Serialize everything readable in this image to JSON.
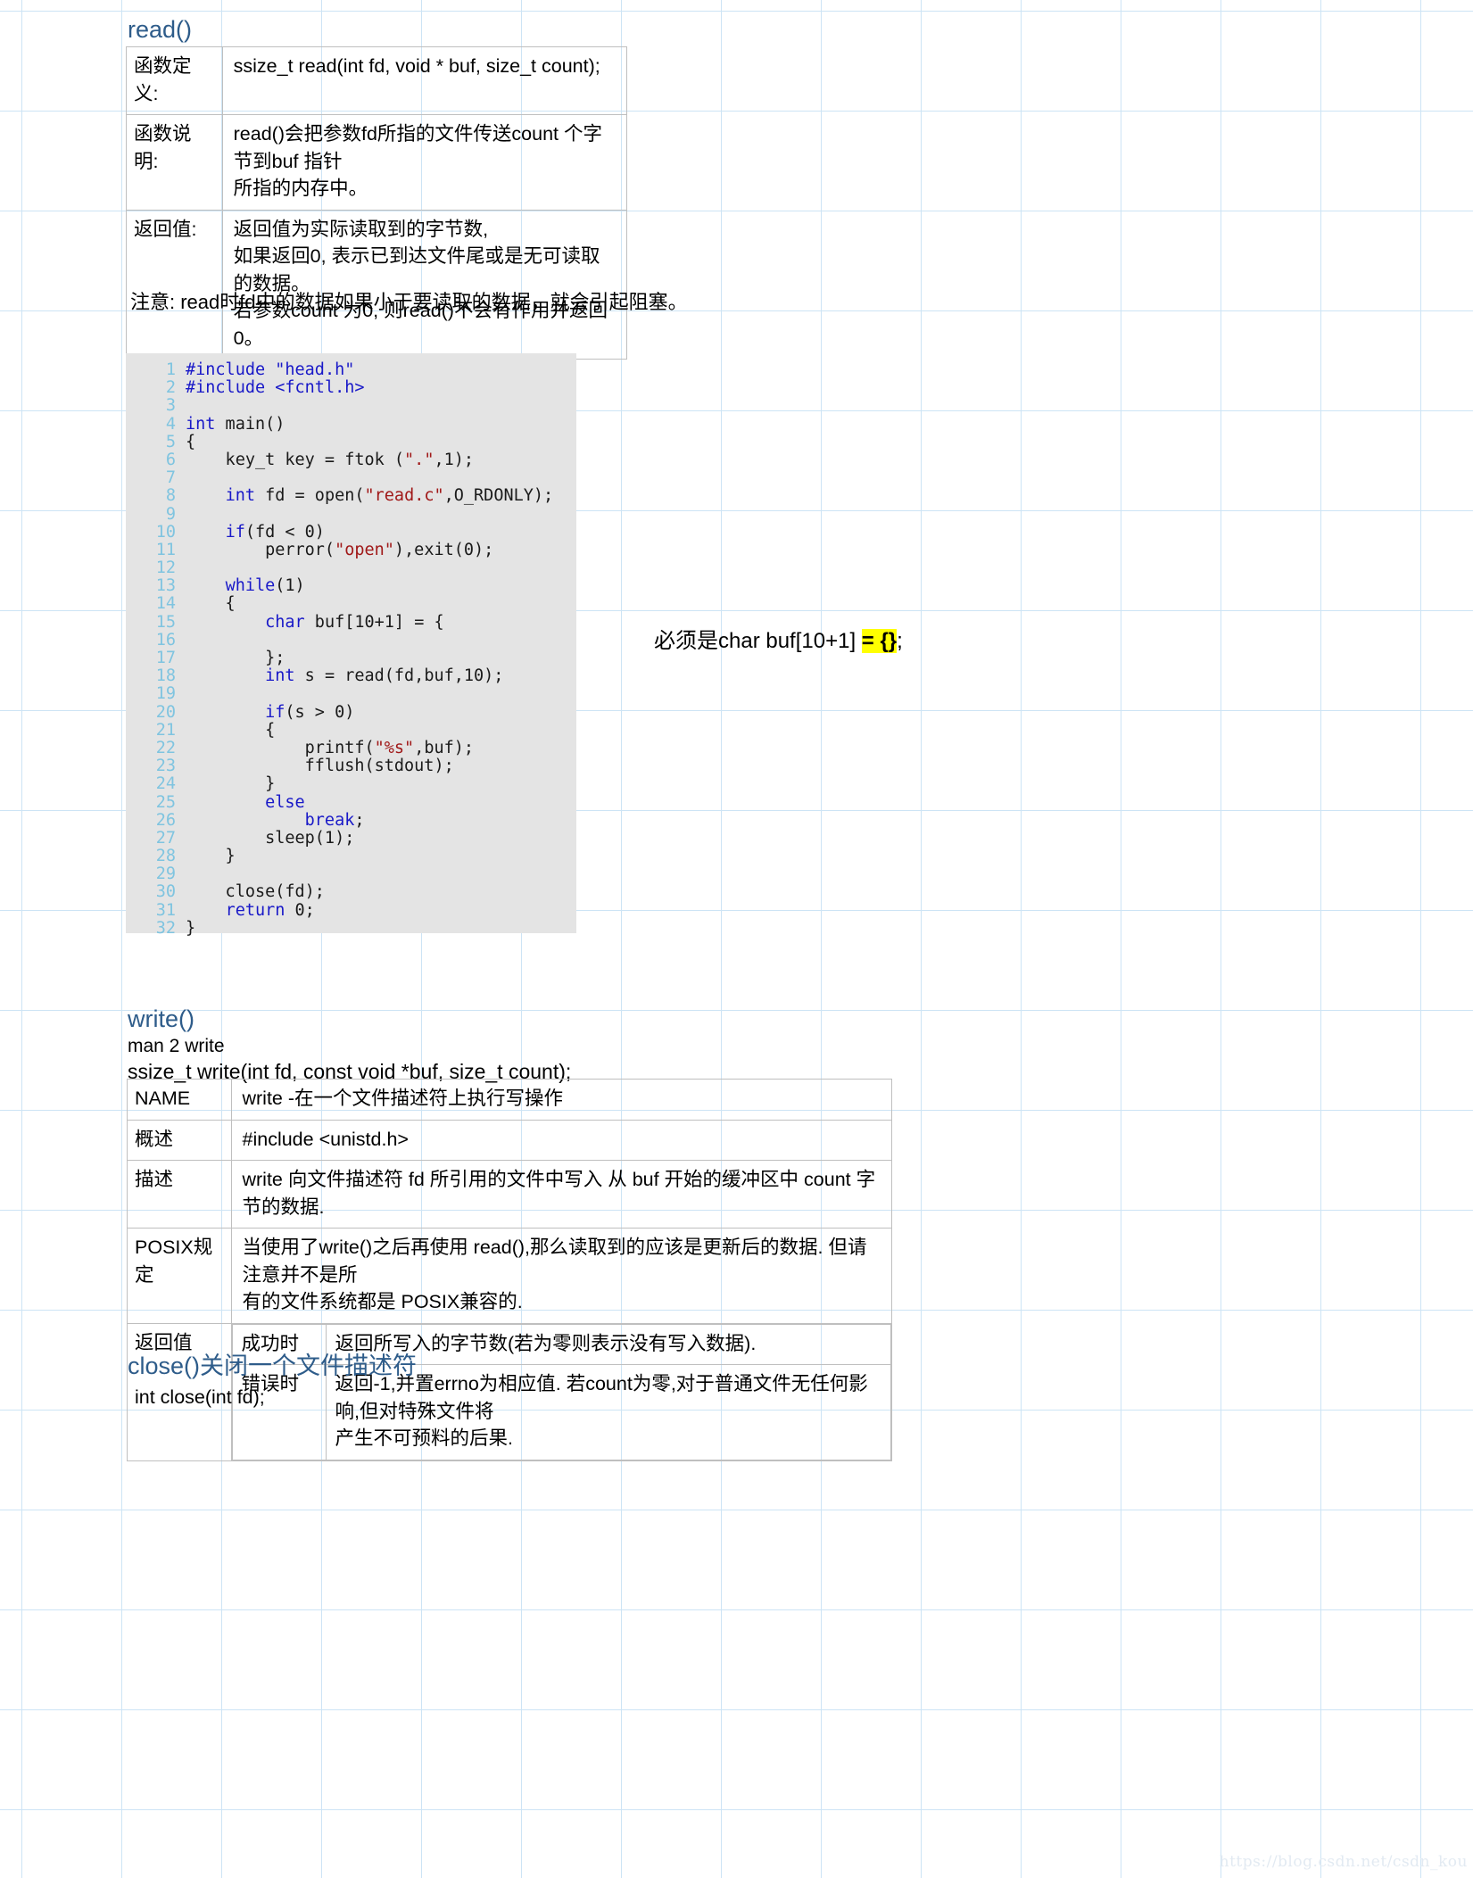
{
  "read_section": {
    "title": "read()",
    "table": [
      {
        "label": "函数定\n义:",
        "lines": [
          "ssize_t read(int fd, void * buf, size_t count);"
        ]
      },
      {
        "label": "函数说\n明:",
        "lines": [
          "read()会把参数fd所指的文件传送count 个字节到buf 指针",
          "所指的内存中。"
        ]
      },
      {
        "label": "返回值:",
        "lines": [
          "返回值为实际读取到的字节数,",
          "如果返回0, 表示已到达文件尾或是无可读取的数据。",
          "若参数count 为0, 则read()不会有作用并返回0。"
        ]
      }
    ],
    "note": "注意: read时fd中的数据如果小于要读取的数据，就会引起阻塞。"
  },
  "annotation": {
    "prefix": "必须是char buf[10+1] ",
    "highlight": "= {}",
    "suffix": ";"
  },
  "code": {
    "lines": [
      {
        "n": "1",
        "tokens": [
          {
            "t": "#include ",
            "c": "inc"
          },
          {
            "t": "\"head.h\"",
            "c": "inc"
          }
        ]
      },
      {
        "n": "2",
        "tokens": [
          {
            "t": "#include ",
            "c": "inc"
          },
          {
            "t": "<fcntl.h>",
            "c": "inc"
          }
        ]
      },
      {
        "n": "3",
        "tokens": []
      },
      {
        "n": "4",
        "tokens": [
          {
            "t": "int",
            "c": "kw"
          },
          {
            "t": " main()",
            "c": "txt"
          }
        ]
      },
      {
        "n": "5",
        "tokens": [
          {
            "t": "{",
            "c": "txt"
          }
        ]
      },
      {
        "n": "6",
        "tokens": [
          {
            "t": "    key_t key = ftok (",
            "c": "txt"
          },
          {
            "t": "\".\"",
            "c": "str"
          },
          {
            "t": ",1);",
            "c": "txt"
          }
        ]
      },
      {
        "n": "7",
        "tokens": []
      },
      {
        "n": "8",
        "tokens": [
          {
            "t": "    ",
            "c": "txt"
          },
          {
            "t": "int",
            "c": "kw"
          },
          {
            "t": " fd = open(",
            "c": "txt"
          },
          {
            "t": "\"read.c\"",
            "c": "str"
          },
          {
            "t": ",O_RDONLY);",
            "c": "txt"
          }
        ]
      },
      {
        "n": "9",
        "tokens": []
      },
      {
        "n": "10",
        "tokens": [
          {
            "t": "    ",
            "c": "txt"
          },
          {
            "t": "if",
            "c": "kw"
          },
          {
            "t": "(fd < 0)",
            "c": "txt"
          }
        ]
      },
      {
        "n": "11",
        "tokens": [
          {
            "t": "        perror(",
            "c": "txt"
          },
          {
            "t": "\"open\"",
            "c": "str"
          },
          {
            "t": "),exit(0);",
            "c": "txt"
          }
        ]
      },
      {
        "n": "12",
        "tokens": []
      },
      {
        "n": "13",
        "tokens": [
          {
            "t": "    ",
            "c": "txt"
          },
          {
            "t": "while",
            "c": "kw"
          },
          {
            "t": "(1)",
            "c": "txt"
          }
        ]
      },
      {
        "n": "14",
        "tokens": [
          {
            "t": "    {",
            "c": "txt"
          }
        ]
      },
      {
        "n": "15",
        "tokens": [
          {
            "t": "        ",
            "c": "txt"
          },
          {
            "t": "char",
            "c": "kw"
          },
          {
            "t": " buf[10+1] = {",
            "c": "txt"
          }
        ]
      },
      {
        "n": "16",
        "tokens": []
      },
      {
        "n": "17",
        "tokens": [
          {
            "t": "        };",
            "c": "txt"
          }
        ]
      },
      {
        "n": "18",
        "tokens": [
          {
            "t": "        ",
            "c": "txt"
          },
          {
            "t": "int",
            "c": "kw"
          },
          {
            "t": " s = read(fd,buf,10);",
            "c": "txt"
          }
        ]
      },
      {
        "n": "19",
        "tokens": []
      },
      {
        "n": "20",
        "tokens": [
          {
            "t": "        ",
            "c": "txt"
          },
          {
            "t": "if",
            "c": "kw"
          },
          {
            "t": "(s > 0)",
            "c": "txt"
          }
        ]
      },
      {
        "n": "21",
        "tokens": [
          {
            "t": "        {",
            "c": "txt"
          }
        ]
      },
      {
        "n": "22",
        "tokens": [
          {
            "t": "            printf(",
            "c": "txt"
          },
          {
            "t": "\"%s\"",
            "c": "str"
          },
          {
            "t": ",buf);",
            "c": "txt"
          }
        ]
      },
      {
        "n": "23",
        "tokens": [
          {
            "t": "            fflush(stdout);",
            "c": "txt"
          }
        ]
      },
      {
        "n": "24",
        "tokens": [
          {
            "t": "        }",
            "c": "txt"
          }
        ]
      },
      {
        "n": "25",
        "tokens": [
          {
            "t": "        ",
            "c": "txt"
          },
          {
            "t": "else",
            "c": "kw"
          }
        ]
      },
      {
        "n": "26",
        "tokens": [
          {
            "t": "            ",
            "c": "txt"
          },
          {
            "t": "break",
            "c": "kw"
          },
          {
            "t": ";",
            "c": "txt"
          }
        ]
      },
      {
        "n": "27",
        "tokens": [
          {
            "t": "        sleep(1);",
            "c": "txt"
          }
        ]
      },
      {
        "n": "28",
        "tokens": [
          {
            "t": "    }",
            "c": "txt"
          }
        ]
      },
      {
        "n": "29",
        "tokens": []
      },
      {
        "n": "30",
        "tokens": [
          {
            "t": "    close(fd);",
            "c": "txt"
          }
        ]
      },
      {
        "n": "31",
        "tokens": [
          {
            "t": "    ",
            "c": "txt"
          },
          {
            "t": "return",
            "c": "kw"
          },
          {
            "t": " 0;",
            "c": "txt"
          }
        ]
      },
      {
        "n": "32",
        "tokens": [
          {
            "t": "}",
            "c": "txt"
          }
        ]
      }
    ]
  },
  "write_section": {
    "title": "write()",
    "man": "man 2 write",
    "prototype": "ssize_t write(int fd, const void *buf, size_t count);",
    "rows": [
      {
        "label": "NAME",
        "lines": [
          "write -在一个文件描述符上执行写操作"
        ]
      },
      {
        "label": "概述",
        "lines": [
          "#include <unistd.h>"
        ]
      },
      {
        "label": "描述",
        "lines": [
          "write 向文件描述符 fd 所引用的文件中写入 从 buf 开始的缓冲区中 count 字节的数据."
        ]
      },
      {
        "label": "POSIX规定",
        "lines": [
          "当使用了write()之后再使用      read(),那么读取到的应该是更新后的数据. 但请注意并不是所",
          "有的文件系统都是 POSIX兼容的."
        ]
      }
    ],
    "return_row": {
      "label": "返回值",
      "items": [
        {
          "k": "成功时",
          "v": [
            "返回所写入的字节数(若为零则表示没有写入数据)."
          ]
        },
        {
          "k": "错误时",
          "v": [
            "返回-1,并置errno为相应值. 若count为零,对于普通文件无任何影响,但对特殊文件将",
            "产生不可预料的后果."
          ]
        }
      ]
    }
  },
  "close_section": {
    "title": "close()关闭一个文件描述符",
    "prototype": "int close(int fd);"
  },
  "watermark": "https://blog.csdn.net/csdn_kou",
  "colors": {
    "heading": "#2e5c8a",
    "grid_line": "#cde4f5",
    "code_bg": "#e4e4e4",
    "keyword": "#1919c8",
    "string": "#a01818",
    "linenum": "#7fc4e0",
    "highlight": "#ffff00",
    "table_border": "#bfbfbf"
  }
}
